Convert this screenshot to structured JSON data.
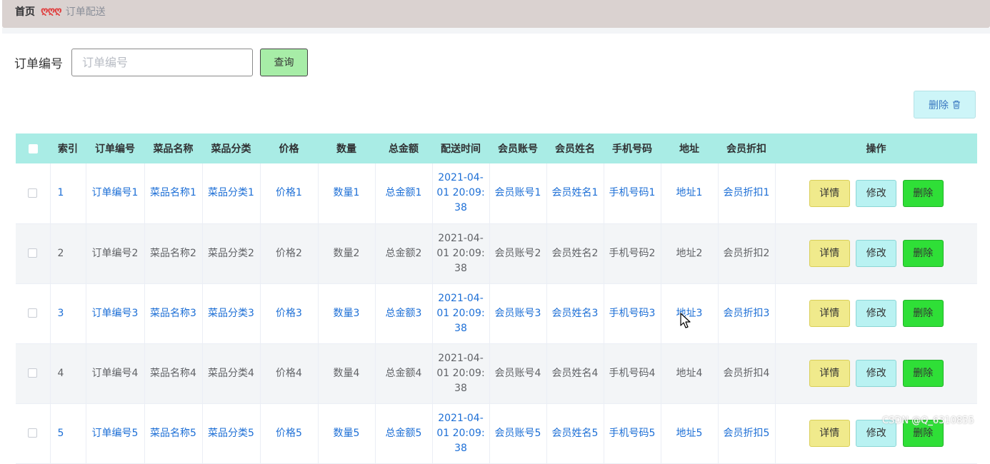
{
  "breadcrumb": {
    "home": "首页",
    "separator": "ღღღ",
    "current": "订单配送"
  },
  "search": {
    "label": "订单编号",
    "placeholder": "订单编号",
    "value": "",
    "button": "查询"
  },
  "toolbar": {
    "delete_label": "删除"
  },
  "table": {
    "columns": [
      "索引",
      "订单编号",
      "菜品名称",
      "菜品分类",
      "价格",
      "数量",
      "总金额",
      "配送时间",
      "会员账号",
      "会员姓名",
      "手机号码",
      "地址",
      "会员折扣",
      "操作"
    ],
    "actions": {
      "detail": "详情",
      "edit": "修改",
      "delete": "删除"
    },
    "rows": [
      {
        "index": "1",
        "order_no": "订单编号1",
        "dish_name": "菜品名称1",
        "dish_category": "菜品分类1",
        "price": "价格1",
        "quantity": "数量1",
        "total": "总金额1",
        "delivery_time": "2021-04-01 20:09:38",
        "member_account": "会员账号1",
        "member_name": "会员姓名1",
        "phone": "手机号码1",
        "address": "地址1",
        "discount": "会员折扣1"
      },
      {
        "index": "2",
        "order_no": "订单编号2",
        "dish_name": "菜品名称2",
        "dish_category": "菜品分类2",
        "price": "价格2",
        "quantity": "数量2",
        "total": "总金额2",
        "delivery_time": "2021-04-01 20:09:38",
        "member_account": "会员账号2",
        "member_name": "会员姓名2",
        "phone": "手机号码2",
        "address": "地址2",
        "discount": "会员折扣2"
      },
      {
        "index": "3",
        "order_no": "订单编号3",
        "dish_name": "菜品名称3",
        "dish_category": "菜品分类3",
        "price": "价格3",
        "quantity": "数量3",
        "total": "总金额3",
        "delivery_time": "2021-04-01 20:09:38",
        "member_account": "会员账号3",
        "member_name": "会员姓名3",
        "phone": "手机号码3",
        "address": "地址3",
        "discount": "会员折扣3"
      },
      {
        "index": "4",
        "order_no": "订单编号4",
        "dish_name": "菜品名称4",
        "dish_category": "菜品分类4",
        "price": "价格4",
        "quantity": "数量4",
        "total": "总金额4",
        "delivery_time": "2021-04-01 20:09:38",
        "member_account": "会员账号4",
        "member_name": "会员姓名4",
        "phone": "手机号码4",
        "address": "地址4",
        "discount": "会员折扣4"
      },
      {
        "index": "5",
        "order_no": "订单编号5",
        "dish_name": "菜品名称5",
        "dish_category": "菜品分类5",
        "price": "价格5",
        "quantity": "数量5",
        "total": "总金额5",
        "delivery_time": "2021-04-01 20:09:38",
        "member_account": "会员账号5",
        "member_name": "会员姓名5",
        "phone": "手机号码5",
        "address": "地址5",
        "discount": "会员折扣5"
      }
    ]
  },
  "watermark": "CSDN @Q_6310855",
  "colors": {
    "header_bg": "#a9ece5",
    "link_blue": "#1d6fd6",
    "detail_btn": "#f0ea8c",
    "edit_btn": "#b9f2f2",
    "delete_btn": "#2fdf37",
    "query_btn": "#a7eda7"
  },
  "icons": {
    "delete_button": "trash-icon",
    "pointer": "mouse-cursor-icon"
  }
}
